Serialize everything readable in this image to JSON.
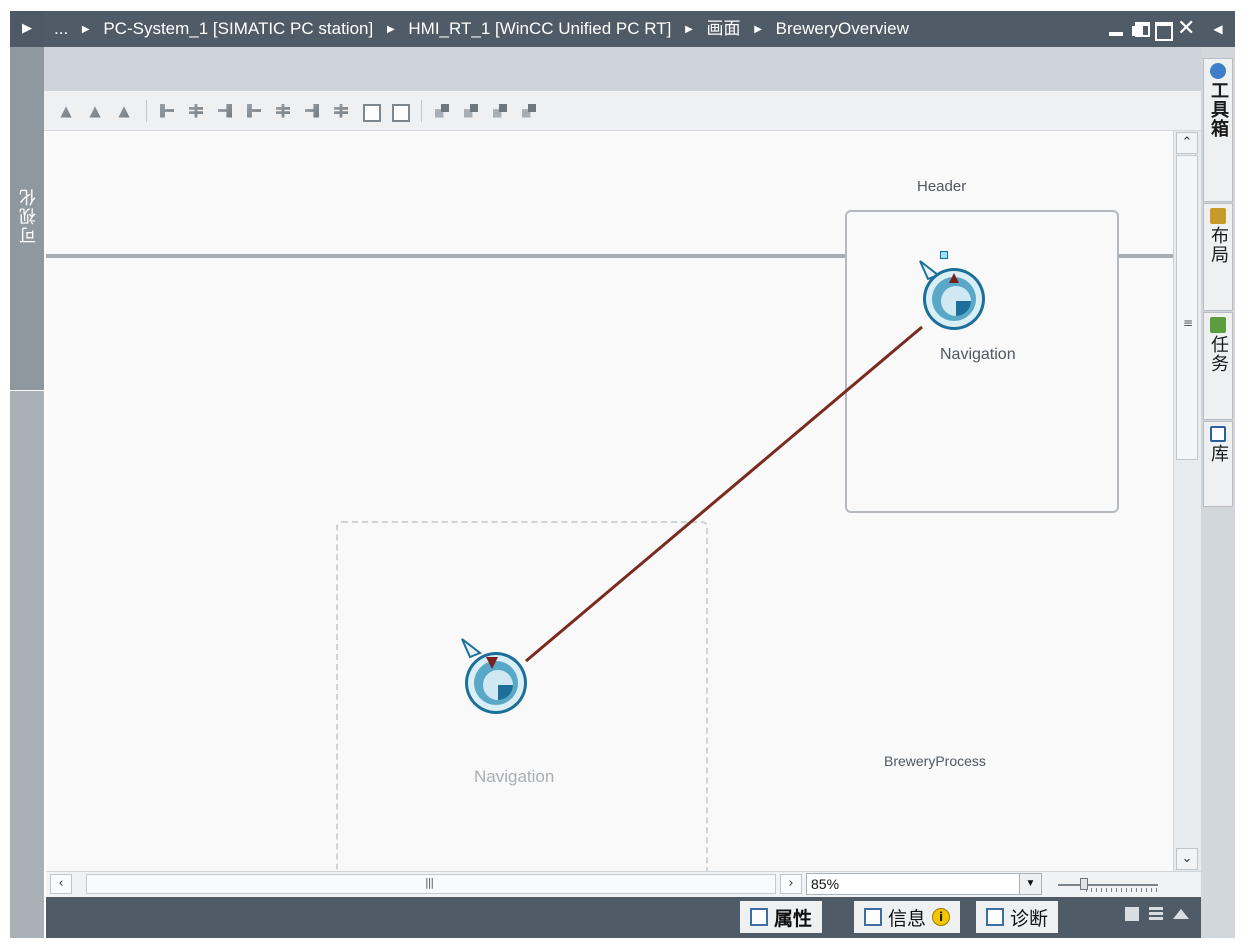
{
  "breadcrumb": {
    "ellipsis": "...",
    "items": [
      "PC-System_1 [SIMATIC PC station]",
      "HMI_RT_1 [WinCC Unified PC RT]",
      "画面",
      "BreweryOverview"
    ]
  },
  "left_panel": {
    "label": "可视化"
  },
  "canvas": {
    "header_label": "Header",
    "nav_label_top": "Navigation",
    "nav_label_bottom": "Navigation",
    "process_label": "BreweryProcess",
    "connector_color": "#7a2a1e"
  },
  "zoom": {
    "value": "85%"
  },
  "bottom_tabs": [
    {
      "label": "属性",
      "icon": "properties-icon"
    },
    {
      "label": "信息",
      "icon": "info-icon"
    },
    {
      "label": "诊断",
      "icon": "diagnostics-icon"
    }
  ],
  "task_cards": [
    {
      "label": "工具箱",
      "icon": "toolbox-icon"
    },
    {
      "label": "布局",
      "icon": "layout-icon"
    },
    {
      "label": "任务",
      "icon": "tasks-icon"
    },
    {
      "label": "库",
      "icon": "libraries-icon"
    }
  ],
  "colors": {
    "titlebar": "#4f5b66",
    "accent_icon": "#1b6f9a"
  }
}
